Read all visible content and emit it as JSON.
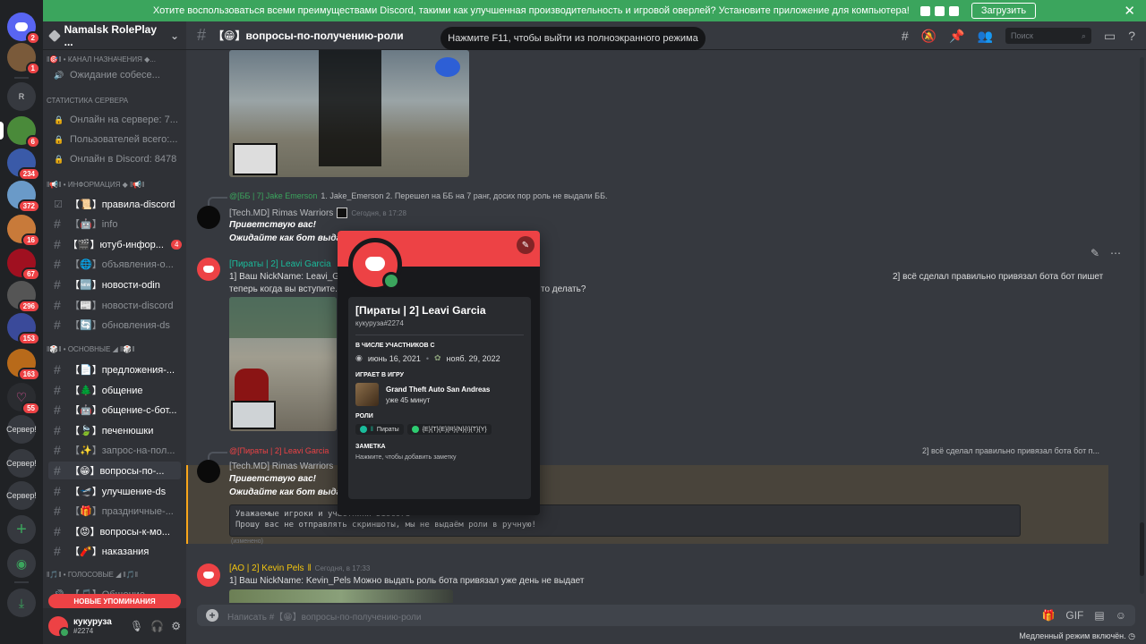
{
  "banner": {
    "text": "Хотите воспользоваться всеми преимуществами Discord, такими как улучшенная производительность и игровой оверлей? Установите приложение для компьютера!",
    "button": "Загрузить"
  },
  "guilds": [
    {
      "badge": "2"
    },
    {
      "badge": "1"
    },
    {
      "label": "R"
    },
    {
      "badge": "6"
    },
    {
      "badge": "234"
    },
    {
      "badge": "372"
    },
    {
      "badge": "16"
    },
    {
      "badge": "67"
    },
    {
      "badge": "296"
    },
    {
      "badge": "153"
    },
    {
      "badge": "163"
    },
    {
      "badge": "55"
    },
    {
      "label": "Сервер!"
    },
    {
      "label": "Сервер!"
    },
    {
      "label": "Сервер!"
    }
  ],
  "server": {
    "name": "Namalsk RolePlay ..."
  },
  "channels": {
    "items": [
      {
        "label": "ǁ🎯ǁ • канал назначения ◆...",
        "type": "cat"
      },
      {
        "label": "Ожидание собесе...",
        "type": "voice"
      },
      {
        "label": "статистика сервера",
        "type": "cat"
      },
      {
        "label": "Онлайн на сервере: 7...",
        "type": "lock"
      },
      {
        "label": "Пользователей всего:...",
        "type": "lock"
      },
      {
        "label": "Онлайн в Discord: 8478",
        "type": "lock"
      },
      {
        "label": "ǁ📢ǁ • информация ◆ ǁ📢ǁ",
        "type": "cat"
      },
      {
        "label": "【📜】правила-discord",
        "type": "rules",
        "unread": true
      },
      {
        "label": "【🤖】info",
        "type": "text"
      },
      {
        "label": "【🎬】ютуб-инфор...",
        "type": "text",
        "unread": true,
        "mention": "4"
      },
      {
        "label": "【🌐】объявления-о...",
        "type": "text"
      },
      {
        "label": "【🆕】новости-odin",
        "type": "text",
        "unread": true
      },
      {
        "label": "【📰】новости-discord",
        "type": "text"
      },
      {
        "label": "【🔄】обновления-ds",
        "type": "text"
      },
      {
        "label": "ǁ🎲ǁ • основные ◢ ǁ🎲ǁ",
        "type": "cat"
      },
      {
        "label": "【📄】предложения-...",
        "type": "text",
        "unread": true
      },
      {
        "label": "【🌲】общение",
        "type": "text",
        "unread": true
      },
      {
        "label": "【🤖】общение-с-бот...",
        "type": "text",
        "unread": true
      },
      {
        "label": "【🍃】печенюшки",
        "type": "text",
        "unread": true
      },
      {
        "label": "【✨】запрос-на-пол...",
        "type": "text"
      },
      {
        "label": "【😁】вопросы-по-...",
        "type": "text",
        "active": true
      },
      {
        "label": "【🛫】улучшение-ds",
        "type": "text",
        "unread": true
      },
      {
        "label": "【🎁】праздничные-...",
        "type": "text"
      },
      {
        "label": "【😡】вопросы-к-мо...",
        "type": "text",
        "unread": true
      },
      {
        "label": "【🧨】наказания",
        "type": "text",
        "unread": true
      },
      {
        "label": "ǁ🎵ǁ • голосовые ◢ ǁ🎵ǁ",
        "type": "cat"
      },
      {
        "label": "【🎵】Общение",
        "type": "voice"
      }
    ],
    "new_mentions": "НОВЫЕ УПОМИНАНИЯ"
  },
  "user": {
    "name": "кукуруза",
    "tag": "#2274"
  },
  "header": {
    "channel": "【😁】вопросы-по-получению-роли",
    "toast": "Нажмите F11, чтобы выйти из полноэкранного режима",
    "search_placeholder": "Поиск"
  },
  "messages": {
    "reply1": {
      "name": "@[ББ | 7] Jake Emerson",
      "text": "1. Jake_Emerson 2. Перешел на ББ на 7 ранг, досих пор роль не выдали ББ."
    },
    "msg1": {
      "author": "[Tech.MD] Rimas Warriors",
      "time": "Сегодня, в 17:28",
      "line1": "Приветствую вас!",
      "line2": "Ожидайте как бот выда..."
    },
    "msg2": {
      "author": "[Пираты | 2] Leavi Garcia",
      "line1": "1] Ваш NickName: Leavi_Ga...",
      "line1_tail": "2] всё сделал правильно привязал бота бот пишет",
      "line2": "теперь когда вы вступите...",
      "line2_tail": "то делать?"
    },
    "reply2": {
      "name": "@[Пираты | 2] Leavi Garcia",
      "text": "2] всё сделал правильно привязал бота бот п..."
    },
    "msg3": {
      "author": "[Tech.MD] Rimas Warriors",
      "line1": "Приветствую вас!",
      "line2": "Ожидайте как бот выда...",
      "code": "Уважаемые игроки и участники Discord\nПрошу вас не отправлять скриншоты, мы не выдаём роли в ручную!",
      "edited": "(изменено)"
    },
    "msg4": {
      "author": "[АО | 2] Kevin Pels",
      "time": "Сегодня, в 17:33",
      "line1": "1] Ваш NickName: Kevin_Pels Можно выдать роль бота привязал уже день не выдает"
    }
  },
  "popout": {
    "name": "[Пираты | 2] Leavi Garcia",
    "tag": "кукуруза#2274",
    "member_since_label": "В ЧИСЛЕ УЧАСТНИКОВ С",
    "discord_date": "июнь 16, 2021",
    "server_date": "нояб. 29, 2022",
    "playing_label": "ИГРАЕТ В ИГРУ",
    "game_name": "Grand Theft Auto San Andreas",
    "game_time": "уже 45 минут",
    "roles_label": "РОЛИ",
    "roles": [
      {
        "name": "Пираты",
        "color": "#1abc9c"
      },
      {
        "name": "{E}{T}{E}{R}{N}{I}{T}{Y}",
        "color": "#2ecc71"
      }
    ],
    "note_label": "ЗАМЕТКА",
    "note_placeholder": "Нажмите, чтобы добавить заметку"
  },
  "composer": {
    "placeholder": "Написать #【😁】вопросы-по-получению-роли"
  },
  "slowmode": "Медленный режим включён."
}
